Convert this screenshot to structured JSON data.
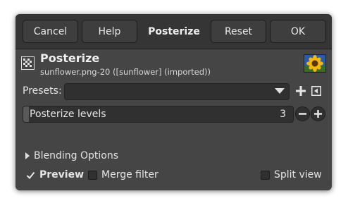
{
  "header": {
    "cancel_label": "Cancel",
    "help_label": "Help",
    "title": "Posterize",
    "reset_label": "Reset",
    "ok_label": "OK"
  },
  "filter": {
    "name": "Posterize",
    "subtitle": "sunflower.png-20 ([sunflower] (imported))",
    "icon": "posterize-icon",
    "thumbnail": "sunflower-thumbnail"
  },
  "presets": {
    "label": "Presets:",
    "value": "",
    "add_icon": "plus-icon",
    "manage_icon": "presets-menu-icon"
  },
  "levels": {
    "label": "Posterize levels",
    "value": "3",
    "fraction": 0.02,
    "decrease_icon": "minus-icon",
    "increase_icon": "plus-icon"
  },
  "blending": {
    "label": "Blending Options",
    "icon": "disclosure-triangle-icon"
  },
  "options": {
    "preview_label": "Preview",
    "preview_checked": true,
    "merge_label": "Merge filter",
    "merge_checked": false,
    "split_label": "Split view",
    "split_checked": false
  },
  "colors": {
    "dialog_bg": "#454545",
    "header_bg": "#353535",
    "field_bg": "#303030",
    "text": "#e6e6e6"
  }
}
